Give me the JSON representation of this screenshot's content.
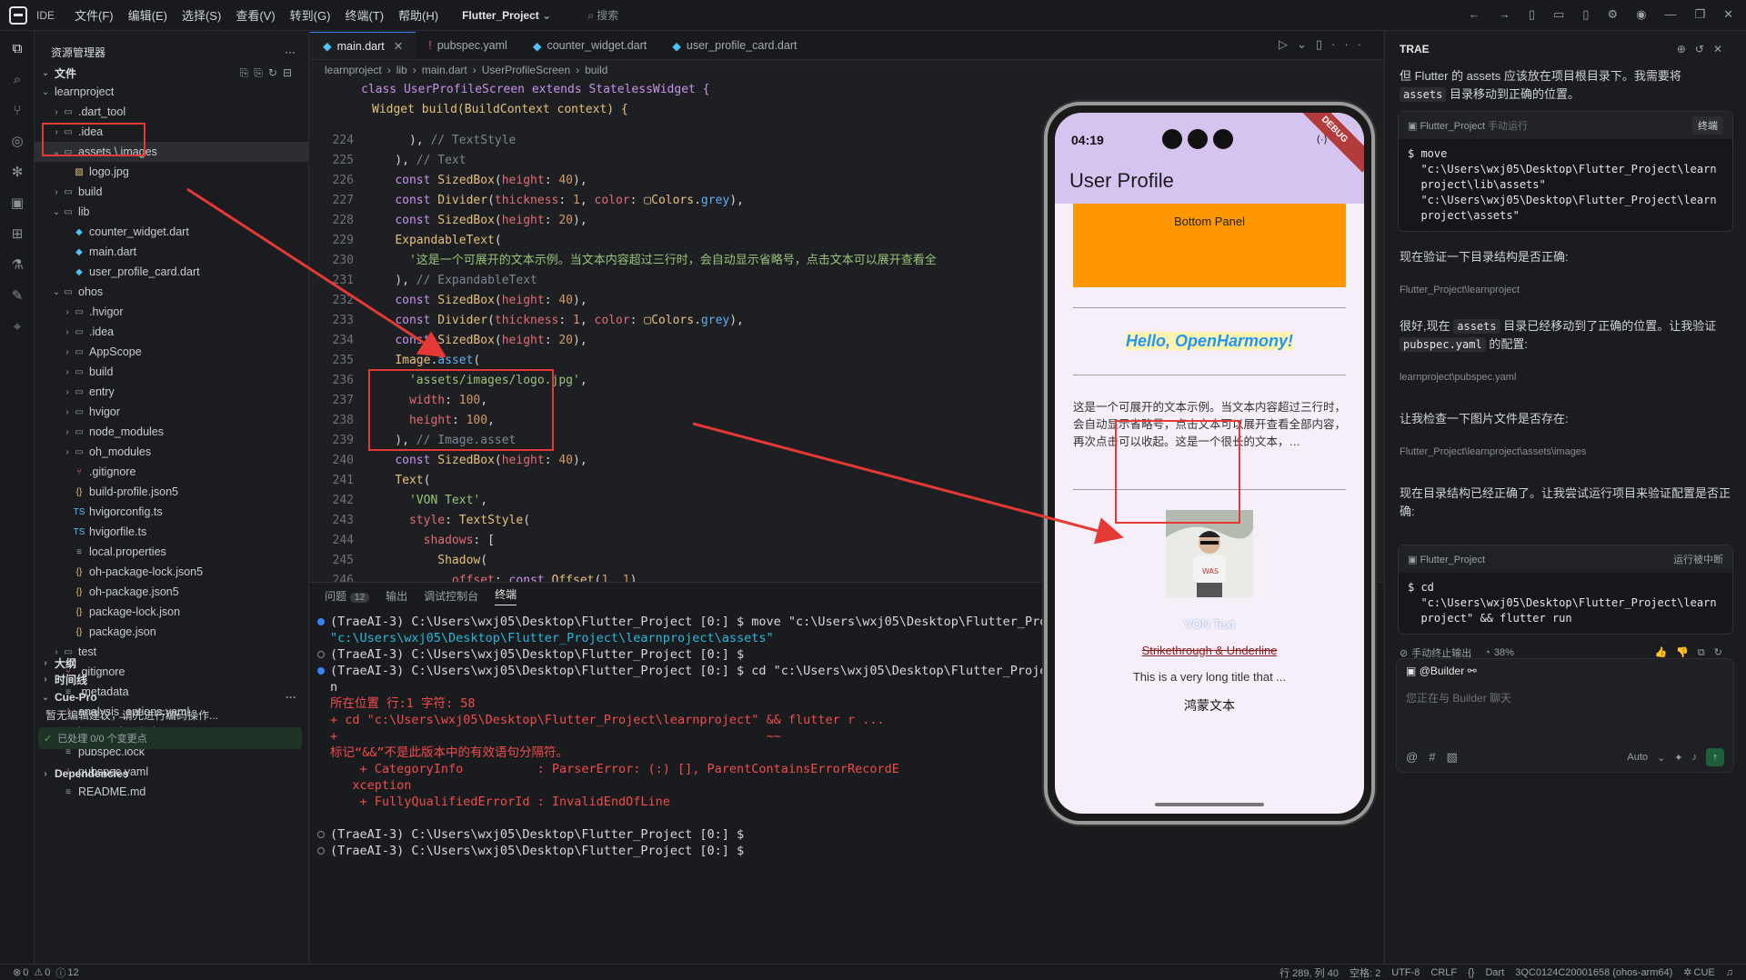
{
  "titlebar": {
    "ide_label": "IDE",
    "menu": [
      "文件(F)",
      "编辑(E)",
      "选择(S)",
      "查看(V)",
      "转到(G)",
      "终端(T)",
      "帮助(H)"
    ],
    "project": "Flutter_Project",
    "search_placeholder": "搜索"
  },
  "explorer": {
    "title": "资源管理器",
    "section": "文件",
    "root": "learnproject",
    "items": [
      {
        "label": ".dart_tool",
        "type": "folder",
        "depth": 1
      },
      {
        "label": ".idea",
        "type": "folder",
        "depth": 1
      },
      {
        "label": "assets \\ images",
        "type": "folder",
        "depth": 1
      },
      {
        "label": "logo.jpg",
        "type": "image",
        "depth": 2
      },
      {
        "label": "build",
        "type": "folder",
        "depth": 1
      },
      {
        "label": "lib",
        "type": "folder",
        "depth": 1
      },
      {
        "label": "counter_widget.dart",
        "type": "dart",
        "depth": 2
      },
      {
        "label": "main.dart",
        "type": "dart",
        "depth": 2
      },
      {
        "label": "user_profile_card.dart",
        "type": "dart",
        "depth": 2
      },
      {
        "label": "ohos",
        "type": "folder",
        "depth": 1
      },
      {
        "label": ".hvigor",
        "type": "folder",
        "depth": 2
      },
      {
        "label": ".idea",
        "type": "folder",
        "depth": 2
      },
      {
        "label": "AppScope",
        "type": "folder",
        "depth": 2
      },
      {
        "label": "build",
        "type": "folder",
        "depth": 2
      },
      {
        "label": "entry",
        "type": "folder",
        "depth": 2
      },
      {
        "label": "hvigor",
        "type": "folder",
        "depth": 2
      },
      {
        "label": "node_modules",
        "type": "folder",
        "depth": 2
      },
      {
        "label": "oh_modules",
        "type": "folder",
        "depth": 2
      },
      {
        "label": ".gitignore",
        "type": "git",
        "depth": 2
      },
      {
        "label": "build-profile.json5",
        "type": "json",
        "depth": 2
      },
      {
        "label": "hvigorconfig.ts",
        "type": "ts",
        "depth": 2
      },
      {
        "label": "hvigorfile.ts",
        "type": "ts",
        "depth": 2
      },
      {
        "label": "local.properties",
        "type": "file",
        "depth": 2
      },
      {
        "label": "oh-package-lock.json5",
        "type": "json",
        "depth": 2
      },
      {
        "label": "oh-package.json5",
        "type": "json",
        "depth": 2
      },
      {
        "label": "package-lock.json",
        "type": "braces",
        "depth": 2
      },
      {
        "label": "package.json",
        "type": "braces",
        "depth": 2
      },
      {
        "label": "test",
        "type": "folder",
        "depth": 1
      },
      {
        "label": ".gitignore",
        "type": "git",
        "depth": 1
      },
      {
        "label": ".metadata",
        "type": "file",
        "depth": 1
      },
      {
        "label": "analysis_options.yaml",
        "type": "yaml",
        "depth": 1
      },
      {
        "label": "learnproject.iml",
        "type": "xml",
        "depth": 1
      },
      {
        "label": "pubspec.lock",
        "type": "file",
        "depth": 1
      },
      {
        "label": "pubspec.yaml",
        "type": "yaml",
        "depth": 1
      },
      {
        "label": "README.md",
        "type": "file",
        "depth": 1
      }
    ],
    "outline": "大纲",
    "timeline": "时间线",
    "cuepro": {
      "title": "Cue-Pro",
      "hint": "暂无编辑建议，请先进行编码操作...",
      "status": "已处理 0/0 个变更点"
    },
    "dependencies": "Dependencies"
  },
  "editor": {
    "tabs": [
      "main.dart",
      "pubspec.yaml",
      "counter_widget.dart",
      "user_profile_card.dart"
    ],
    "breadcrumb": [
      "learnproject",
      "lib",
      "main.dart",
      "UserProfileScreen",
      "build"
    ],
    "sticky1": "class UserProfileScreen extends StatelessWidget {",
    "sticky2": "Widget build(BuildContext context) {",
    "line_numbers": [
      "224",
      "225",
      "226",
      "227",
      "228",
      "229",
      "230",
      "231",
      "232",
      "233",
      "234",
      "235",
      "236",
      "237",
      "238",
      "239",
      "240",
      "241",
      "242",
      "243",
      "244",
      "245",
      "246"
    ]
  },
  "panel": {
    "tabs": [
      "问题",
      "输出",
      "调试控制台",
      "终端"
    ],
    "problem_count": "12",
    "terminal": [
      "(TraeAI-3) C:\\Users\\wxj05\\Desktop\\Flutter_Project [0:] $ move \"c:\\Users\\wxj05\\Desktop\\Flutter_Proj",
      "\"c:\\Users\\wxj05\\Desktop\\Flutter_Project\\learnproject\\assets\"",
      "(TraeAI-3) C:\\Users\\wxj05\\Desktop\\Flutter_Project [0:] $",
      "(TraeAI-3) C:\\Users\\wxj05\\Desktop\\Flutter_Project [0:] $ cd \"c:\\Users\\wxj05\\Desktop\\Flutter_Projec",
      "n",
      "所在位置 行:1 字符: 58",
      "+ cd \"c:\\Users\\wxj05\\Desktop\\Flutter_Project\\learnproject\" && flutter r ...",
      "+                                                          ~~",
      "标记“&&”不是此版本中的有效语句分隔符。",
      "    + CategoryInfo          : ParserError: (:) [], ParentContainsErrorRecordE",
      "   xception",
      "    + FullyQualifiedErrorId : InvalidEndOfLine",
      "",
      "(TraeAI-3) C:\\Users\\wxj05\\Desktop\\Flutter_Project [0:] $",
      "(TraeAI-3) C:\\Users\\wxj05\\Desktop\\Flutter_Project [0:] $"
    ]
  },
  "phone": {
    "time": "04:19",
    "debug": "DEBUG",
    "title": "User Profile",
    "bottom_panel": "Bottom Panel",
    "hello": "Hello, OpenHarmony!",
    "expandable": "这是一个可展开的文本示例。当文本内容超过三行时，会自动显示省略号，点击文本可以展开查看全部内容，再次点击可以收起。这是一个很长的文本，…",
    "von": "VON Text",
    "strike": "Strikethrough & Underline",
    "long_title": "This is a very long title that ...",
    "hongmeng": "鸿蒙文本"
  },
  "ai": {
    "title": "TRAE",
    "msg1": "但 Flutter 的 assets 应该放在项目根目录下。我需要将",
    "msg1b": "目录移动到正确的位置。",
    "assets_code": "assets",
    "cmd1_head": "Flutter_Project",
    "cmd1_mode": "手动运行",
    "cmd1_btn": "终端",
    "cmd1_body": "$ move\n  \"c:\\Users\\wxj05\\Desktop\\Flutter_Project\\learn\n  project\\lib\\assets\"\n  \"c:\\Users\\wxj05\\Desktop\\Flutter_Project\\learn\n  project\\assets\"",
    "msg2": "现在验证一下目录结构是否正确:",
    "path1": "Flutter_Project\\learnproject",
    "msg3a": "很好,现在",
    "msg3b": "目录已经移动到了正确的位置。让我验证",
    "msg3c": "pubspec.yaml 的配置:",
    "pubspec_code": "pubspec.yaml",
    "path2": "learnproject\\pubspec.yaml",
    "msg4": "让我检查一下图片文件是否存在:",
    "path3": "Flutter_Project\\learnproject\\assets\\images",
    "msg5": "现在目录结构已经正确了。让我尝试运行项目来验证配置是否正确:",
    "cmd2_head": "Flutter_Project",
    "cmd2_status": "运行被中断",
    "cmd2_body": "$ cd\n  \"c:\\Users\\wxj05\\Desktop\\Flutter_Project\\learn\n  project\" && flutter run",
    "stop_label": "手动终止输出",
    "progress": "38%",
    "builder": "@Builder",
    "input_placeholder": "您正在与 Builder 聊天",
    "auto": "Auto"
  },
  "statusbar": {
    "errors": "0",
    "warnings": "0",
    "infos": "12",
    "position": "行 289, 列 40",
    "spaces": "空格: 2",
    "encoding": "UTF-8",
    "eol": "CRLF",
    "lang": "Dart",
    "device": "3QC0124C20001658 (ohos-arm64)",
    "cue": "CUE"
  },
  "colors": {
    "accent": "#3b82f6",
    "annotation": "#e53935",
    "appbar": "#d6c4f0",
    "orange": "#ff9800"
  }
}
